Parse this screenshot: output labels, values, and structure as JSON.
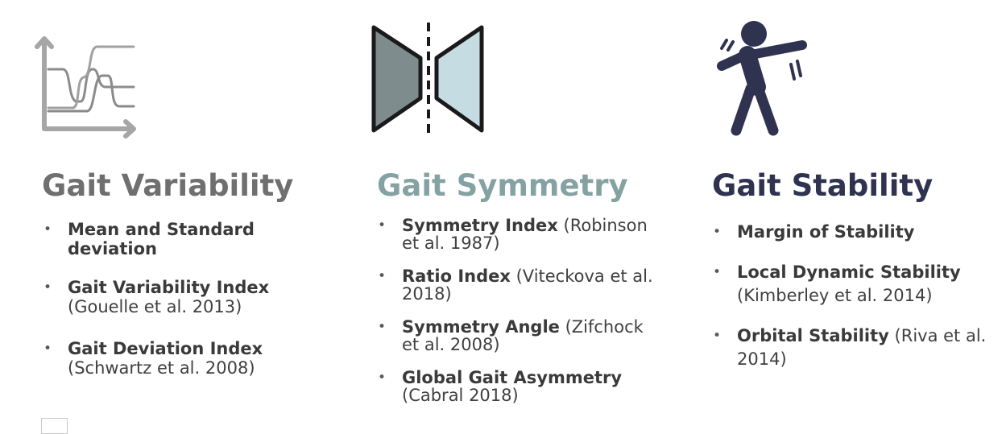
{
  "columns": [
    {
      "title": "Gait Variability",
      "icon": "line-graph-icon",
      "title_color": "#6f6f6f",
      "items": [
        {
          "title": "Mean and Standard deviation",
          "ref": ""
        },
        {
          "title": "Gait Variability Index",
          "ref": "(Gouelle et al. 2013)"
        },
        {
          "title": "Gait Deviation Index",
          "ref": "(Schwartz et al. 2008)"
        }
      ]
    },
    {
      "title": "Gait Symmetry",
      "icon": "mirror-symmetry-icon",
      "title_color": "#85a2a3",
      "items": [
        {
          "title": "Symmetry Index",
          "ref": "(Robinson et al. 1987)"
        },
        {
          "title": "Ratio Index",
          "ref": "(Viteckova et al. 2018)"
        },
        {
          "title": "Symmetry Angle",
          "ref": "(Zifchock et al. 2008)"
        },
        {
          "title": "Global Gait Asymmetry",
          "ref": "(Cabral 2018)"
        }
      ]
    },
    {
      "title": "Gait Stability",
      "icon": "falling-person-icon",
      "title_color": "#2f3350",
      "items": [
        {
          "title": "Margin of Stability",
          "ref": ""
        },
        {
          "title": "Local Dynamic Stability",
          "ref": "(Kimberley et al. 2014)"
        },
        {
          "title": "Orbital Stability",
          "ref": "(Riva et al. 2014)"
        }
      ]
    }
  ]
}
